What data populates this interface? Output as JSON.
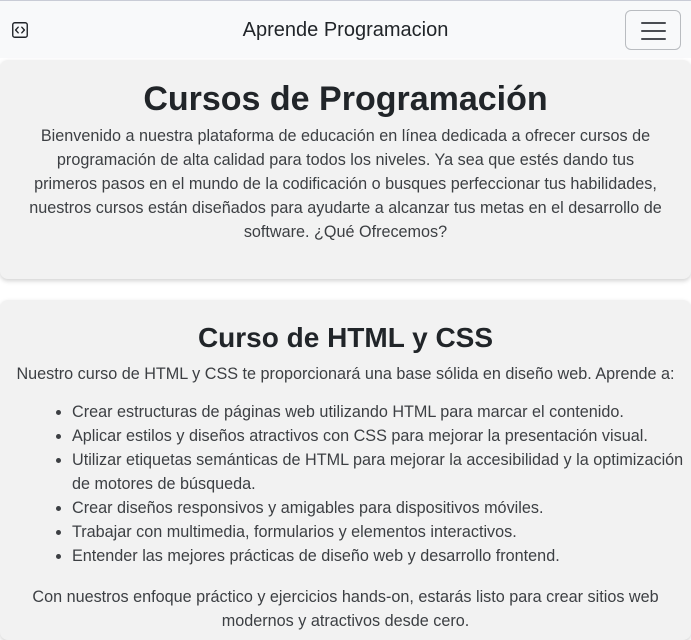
{
  "navbar": {
    "brand_icon": "code-window-icon",
    "title": "Aprende Programacion",
    "toggler_icon": "hamburger-menu-icon"
  },
  "hero": {
    "title": "Cursos de Programación",
    "intro": "Bienvenido a nuestra plataforma de educación en línea dedicada a ofrecer cursos de programación de alta calidad para todos los niveles. Ya sea que estés dando tus primeros pasos en el mundo de la codificación o busques perfeccionar tus habilidades, nuestros cursos están diseñados para ayudarte a alcanzar tus metas en el desarrollo de software. ¿Qué Ofrecemos?"
  },
  "course": {
    "title": "Curso de HTML y CSS",
    "lead": "Nuestro curso de HTML y CSS te proporcionará una base sólida en diseño web. Aprende a:",
    "items": [
      "Crear estructuras de páginas web utilizando HTML para marcar el contenido.",
      "Aplicar estilos y diseños atractivos con CSS para mejorar la presentación visual.",
      "Utilizar etiquetas semánticas de HTML para mejorar la accesibilidad y la optimización de motores de búsqueda.",
      "Crear diseños responsivos y amigables para dispositivos móviles.",
      "Trabajar con multimedia, formularios y elementos interactivos.",
      "Entender las mejores prácticas de diseño web y desarrollo frontend."
    ],
    "closing": "Con nuestros enfoque práctico y ejercicios hands-on, estarás listo para crear sitios web modernos y atractivos desde cero."
  }
}
